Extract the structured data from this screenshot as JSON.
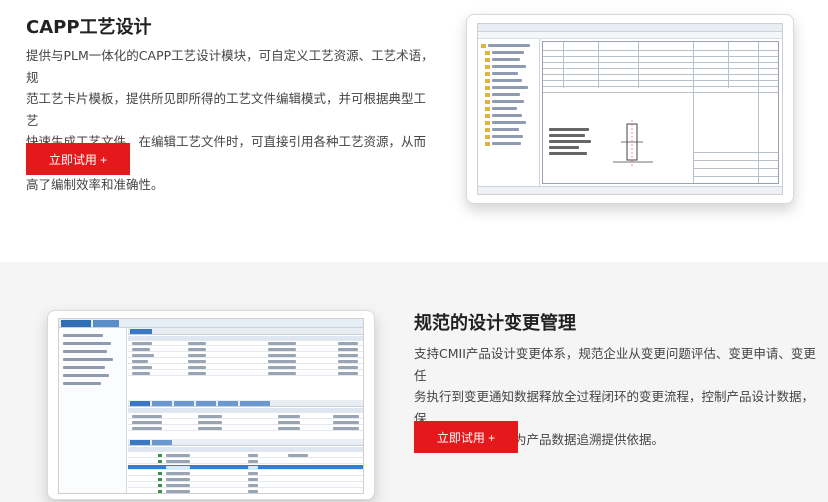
{
  "section_capp": {
    "title": "CAPP工艺设计",
    "description_lines": [
      "提供与PLM一体化的CAPP工艺设计模块，可自定义工艺资源、工艺术语，规",
      "范工艺卡片模板，提供所见即所得的工艺文件编辑模式，并可根据典型工艺",
      "快速生成工艺文件，在编辑工艺文件时，可直接引用各种工艺资源，从而提",
      "高了编制效率和准确性。"
    ],
    "cta_label": "立即试用 +"
  },
  "section_change": {
    "title": "规范的设计变更管理",
    "description_lines": [
      "支持CMII产品设计变更体系，规范企业从变更问题评估、变更申请、变更任",
      "务执行到变更通知数据释放全过程闭环的变更流程，控制产品设计数据，保",
      "证产品设计质量，为产品数据追溯提供依据。"
    ],
    "cta_label": "立即试用 +"
  },
  "colors": {
    "accent": "#e5191b",
    "section2_bg": "#f5f5f5",
    "selection_blue": "#2f7fd8"
  }
}
